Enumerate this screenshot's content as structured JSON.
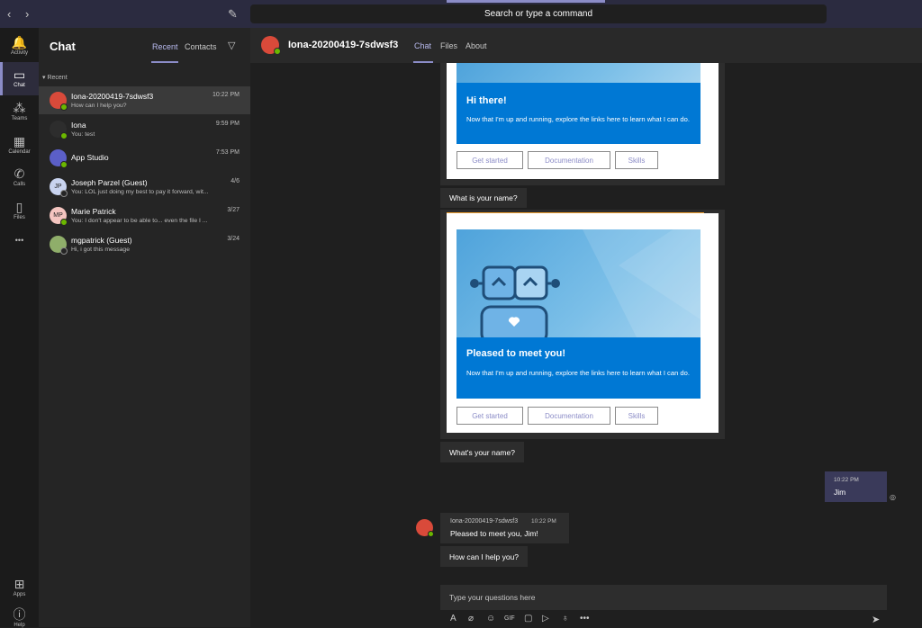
{
  "topbar": {
    "back_icon": "chevron-left-icon",
    "forward_icon": "chevron-right-icon",
    "compose_icon": "compose-icon",
    "search_placeholder": "Search or type a command"
  },
  "rail": {
    "items": [
      {
        "label": "Activity",
        "icon": "bell-icon",
        "glyph": "🔔"
      },
      {
        "label": "Chat",
        "icon": "chat-icon",
        "glyph": "▭"
      },
      {
        "label": "Teams",
        "icon": "teams-icon",
        "glyph": "⁂"
      },
      {
        "label": "Calendar",
        "icon": "calendar-icon",
        "glyph": "▦"
      },
      {
        "label": "Calls",
        "icon": "phone-icon",
        "glyph": "✆"
      },
      {
        "label": "Files",
        "icon": "file-icon",
        "glyph": "▯"
      }
    ],
    "more_glyph": "•••",
    "apps_label": "Apps",
    "help_label": "Help"
  },
  "chat_list": {
    "title": "Chat",
    "tab_recent": "Recent",
    "tab_contacts": "Contacts",
    "section": "Recent",
    "rows": [
      {
        "name": "Iona-20200419-7sdwsf3",
        "preview": "How can I help you?",
        "time": "10:22 PM",
        "initials": "",
        "avatar_color": "#d94a3a",
        "status": "online"
      },
      {
        "name": "Iona",
        "preview": "You: test",
        "time": "9:59 PM",
        "initials": "",
        "avatar_color": "#2d2d2d",
        "status": "online"
      },
      {
        "name": "App Studio",
        "preview": "",
        "time": "7:53 PM",
        "initials": "",
        "avatar_color": "#5b5fc7",
        "status": "online"
      },
      {
        "name": "Joseph Parzel (Guest)",
        "preview": "You: LOL just doing my best to pay it forward, wit...",
        "time": "4/6",
        "initials": "JP",
        "avatar_color": "#c9d4f0",
        "status": "offline"
      },
      {
        "name": "Marie Patrick",
        "preview": "You: I don't appear to be able to... even the file I ...",
        "time": "3/27",
        "initials": "MP",
        "avatar_color": "#f4c5c0",
        "status": "online"
      },
      {
        "name": "mgpatrick (Guest)",
        "preview": "Hi, i got this message",
        "time": "3/24",
        "initials": "",
        "avatar_color": "#8fae6a",
        "status": "offline"
      }
    ]
  },
  "conversation": {
    "title": "Iona-20200419-7sdwsf3",
    "tab_chat": "Chat",
    "tab_files": "Files",
    "tab_about": "About",
    "card1": {
      "heading": "Hi there!",
      "text": "Now that I'm up and running, explore the links here to learn what I can do.",
      "btn1": "Get started",
      "btn2": "Documentation",
      "btn3": "Skills"
    },
    "msg1": "What is your name?",
    "card2": {
      "heading": "Pleased to meet you!",
      "text": "Now that I'm up and running, explore the links here to learn what I can do.",
      "btn1": "Get started",
      "btn2": "Documentation",
      "btn3": "Skills"
    },
    "msg2": "What's your name?",
    "self_time": "10:22 PM",
    "self_text": "Jim",
    "bot_name": "Iona-20200419-7sdwsf3",
    "bot_time": "10:22 PM",
    "bot_text": "Pleased to meet you, Jim!",
    "msg3": "How can I help you?",
    "composer_placeholder": "Type your questions here"
  },
  "colors": {
    "accent": "#8b8cc7",
    "card_blue": "#0078d4",
    "online": "#6bb700"
  }
}
